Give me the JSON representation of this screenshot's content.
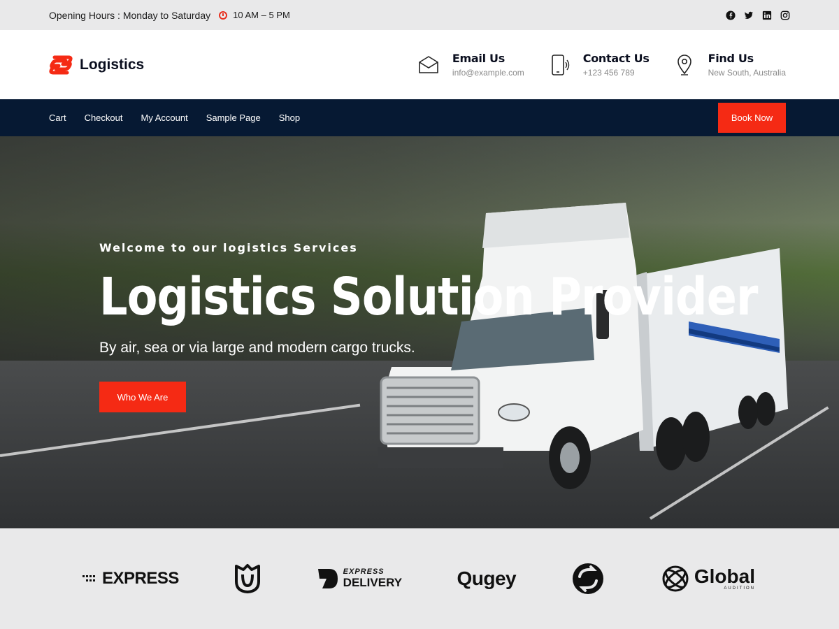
{
  "topbar": {
    "hours_label": "Opening Hours : Monday to Saturday",
    "time": "10 AM – 5 PM",
    "social_icons": [
      "facebook-icon",
      "twitter-icon",
      "linkedin-icon",
      "instagram-icon"
    ]
  },
  "header": {
    "brand_name": "Logistics",
    "contacts": [
      {
        "title": "Email Us",
        "sub": "info@example.com",
        "icon": "mail-icon"
      },
      {
        "title": "Contact Us",
        "sub": "+123 456 789",
        "icon": "phone-icon"
      },
      {
        "title": "Find Us",
        "sub": "New South, Australia",
        "icon": "location-pin-icon"
      }
    ]
  },
  "nav": {
    "links": [
      "Cart",
      "Checkout",
      "My Account",
      "Sample Page",
      "Shop"
    ],
    "cta": "Book Now"
  },
  "hero": {
    "kicker": "Welcome to our logistics Services",
    "title": "Logistics Solution Provider",
    "subtitle": "By air, sea or via large and modern cargo trucks.",
    "button": "Who We Are"
  },
  "logos": {
    "express": "EXPRESS",
    "delivery_top": "EXPRESS",
    "delivery_bottom": "DELIVERY",
    "qugey": "Qugey",
    "global": "Global",
    "global_sub": "AUDITION"
  },
  "colors": {
    "accent": "#f52a14",
    "nav_bg": "#061933",
    "topbar_bg": "#e9e9ea"
  }
}
